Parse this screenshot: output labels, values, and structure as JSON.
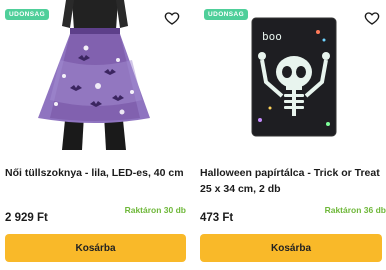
{
  "products": [
    {
      "badge": "UDONSAG",
      "title": "Női tüllszoknya - lila, LED-es, 40 cm",
      "stock": "Raktáron 30 db",
      "price": "2 929 Ft",
      "cart_label": "Kosárba"
    },
    {
      "badge": "UDONSAG",
      "title": "Halloween papírtálca - Trick or Treat 25 x 34 cm, 2 db",
      "stock": "Raktáron 36 db",
      "price": "473 Ft",
      "cart_label": "Kosárba",
      "tray_text": "boo"
    }
  ],
  "colors": {
    "badge": "#4fcf9a",
    "stock": "#6fb83a",
    "button": "#f9b929",
    "skirt": "#7b5aa8"
  }
}
